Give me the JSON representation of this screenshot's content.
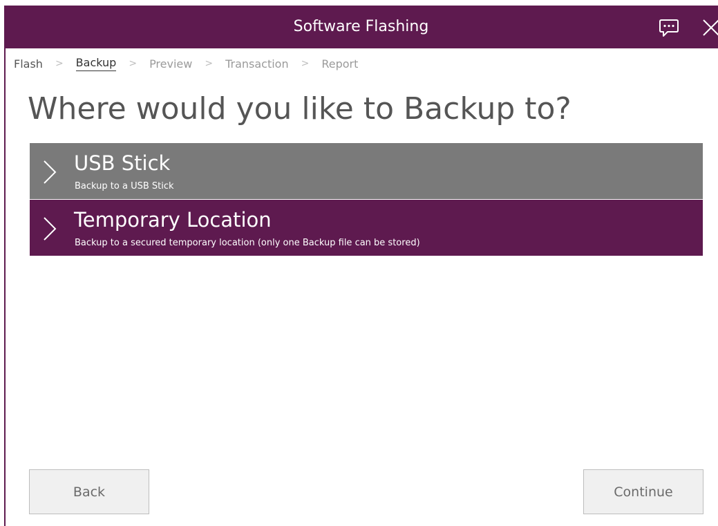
{
  "window": {
    "title": "Software Flashing",
    "accent_color": "#5e1a4f",
    "icons": [
      "chat-bubble-icon",
      "close-icon"
    ]
  },
  "breadcrumb": {
    "steps": [
      {
        "label": "Flash",
        "state": "done"
      },
      {
        "label": "Backup",
        "state": "current"
      },
      {
        "label": "Preview",
        "state": "upcoming"
      },
      {
        "label": "Transaction",
        "state": "upcoming"
      },
      {
        "label": "Report",
        "state": "upcoming"
      }
    ],
    "separator": ">"
  },
  "main": {
    "heading": "Where would you like to Backup to?",
    "options": [
      {
        "title": "USB Stick",
        "subtitle": "Backup to a USB Stick",
        "color": "#7a7a7a",
        "icon": "chevron-right-icon"
      },
      {
        "title": "Temporary Location",
        "subtitle": "Backup to a secured temporary location (only one Backup file can be stored)",
        "color": "#5e1a4f",
        "icon": "chevron-right-icon"
      }
    ]
  },
  "footer": {
    "back_label": "Back",
    "continue_label": "Continue"
  }
}
